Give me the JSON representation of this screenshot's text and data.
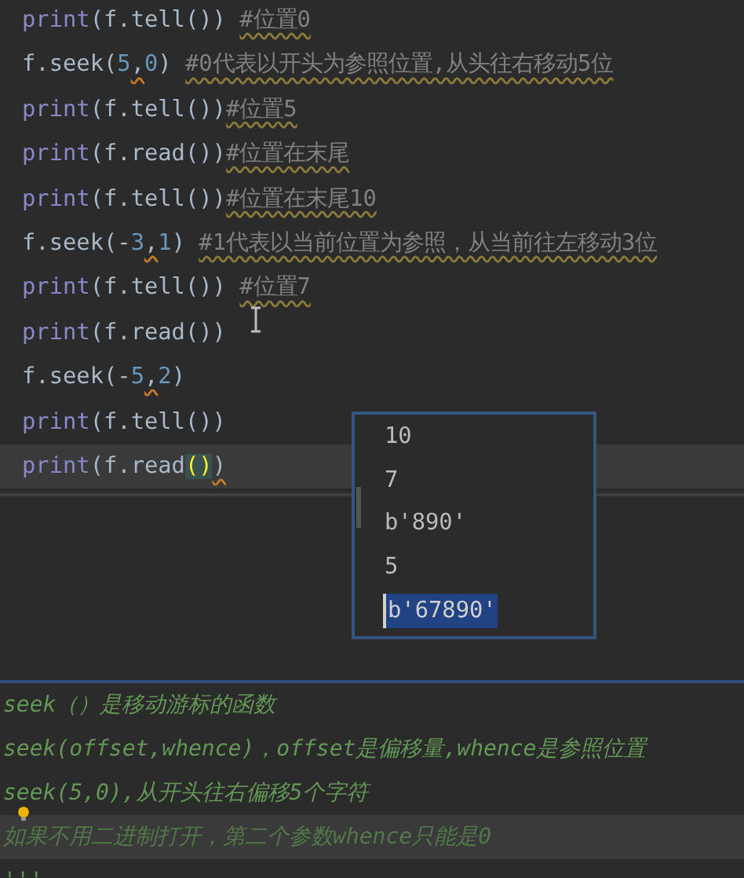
{
  "code_lines": [
    {
      "current": false,
      "segments": [
        {
          "kind": "builtin",
          "text": "print"
        },
        {
          "kind": "plain",
          "text": "(f.tell()) "
        },
        {
          "kind": "comment",
          "text": "#位置0"
        }
      ]
    },
    {
      "current": false,
      "segments": [
        {
          "kind": "plain",
          "text": "f.seek("
        },
        {
          "kind": "number",
          "text": "5"
        },
        {
          "kind": "warn",
          "text": ","
        },
        {
          "kind": "number",
          "text": "0"
        },
        {
          "kind": "plain",
          "text": ") "
        },
        {
          "kind": "comment",
          "text": "#0代表以开头为参照位置,从头往右移动5位"
        }
      ]
    },
    {
      "current": false,
      "segments": [
        {
          "kind": "builtin",
          "text": "print"
        },
        {
          "kind": "plain",
          "text": "(f.tell())"
        },
        {
          "kind": "comment",
          "text": "#位置5"
        }
      ]
    },
    {
      "current": false,
      "segments": [
        {
          "kind": "builtin",
          "text": "print"
        },
        {
          "kind": "plain",
          "text": "(f.read())"
        },
        {
          "kind": "comment",
          "text": "#位置在末尾"
        }
      ]
    },
    {
      "current": false,
      "segments": [
        {
          "kind": "builtin",
          "text": "print"
        },
        {
          "kind": "plain",
          "text": "(f.tell())"
        },
        {
          "kind": "comment",
          "text": "#位置在末尾10"
        }
      ]
    },
    {
      "current": false,
      "segments": [
        {
          "kind": "plain",
          "text": "f.seek(-"
        },
        {
          "kind": "number",
          "text": "3"
        },
        {
          "kind": "warn",
          "text": ","
        },
        {
          "kind": "number",
          "text": "1"
        },
        {
          "kind": "plain",
          "text": ") "
        },
        {
          "kind": "comment",
          "text": "#1代表以当前位置为参照，从当前往左移动3位"
        }
      ]
    },
    {
      "current": false,
      "segments": [
        {
          "kind": "builtin",
          "text": "print"
        },
        {
          "kind": "plain",
          "text": "(f.tell()) "
        },
        {
          "kind": "comment",
          "text": "#位置7"
        }
      ]
    },
    {
      "current": false,
      "segments": [
        {
          "kind": "builtin",
          "text": "print"
        },
        {
          "kind": "plain",
          "text": "(f.read())"
        }
      ]
    },
    {
      "current": false,
      "segments": [
        {
          "kind": "plain",
          "text": "f.seek(-"
        },
        {
          "kind": "number",
          "text": "5"
        },
        {
          "kind": "warn",
          "text": ","
        },
        {
          "kind": "number",
          "text": "2"
        },
        {
          "kind": "plain",
          "text": ")"
        }
      ]
    },
    {
      "current": false,
      "segments": [
        {
          "kind": "builtin",
          "text": "print"
        },
        {
          "kind": "plain",
          "text": "(f.tell())"
        }
      ]
    },
    {
      "current": true,
      "segments": [
        {
          "kind": "builtin",
          "text": "print"
        },
        {
          "kind": "plain",
          "text": "(f.read"
        },
        {
          "kind": "match",
          "text": "()"
        },
        {
          "kind": "warn",
          "text": ")"
        }
      ]
    }
  ],
  "output_popup": {
    "rows": [
      {
        "text": "10",
        "selected": false
      },
      {
        "text": "7",
        "selected": false
      },
      {
        "text": "b'890'",
        "selected": false
      },
      {
        "text": "5",
        "selected": false
      },
      {
        "text": "b'67890'",
        "selected": true
      }
    ]
  },
  "docstring_lines": [
    {
      "text": "seek（）是移动游标的函数",
      "current": false
    },
    {
      "text": "seek(offset,whence)，offset是偏移量,whence是参照位置",
      "current": false
    },
    {
      "text": "seek(5,0),从开头往右偏移5个字符",
      "current": false
    },
    {
      "text": "如果不用二进制打开，第二个参数whence只能是0",
      "current": true
    },
    {
      "text": "'''",
      "current": false
    }
  ]
}
